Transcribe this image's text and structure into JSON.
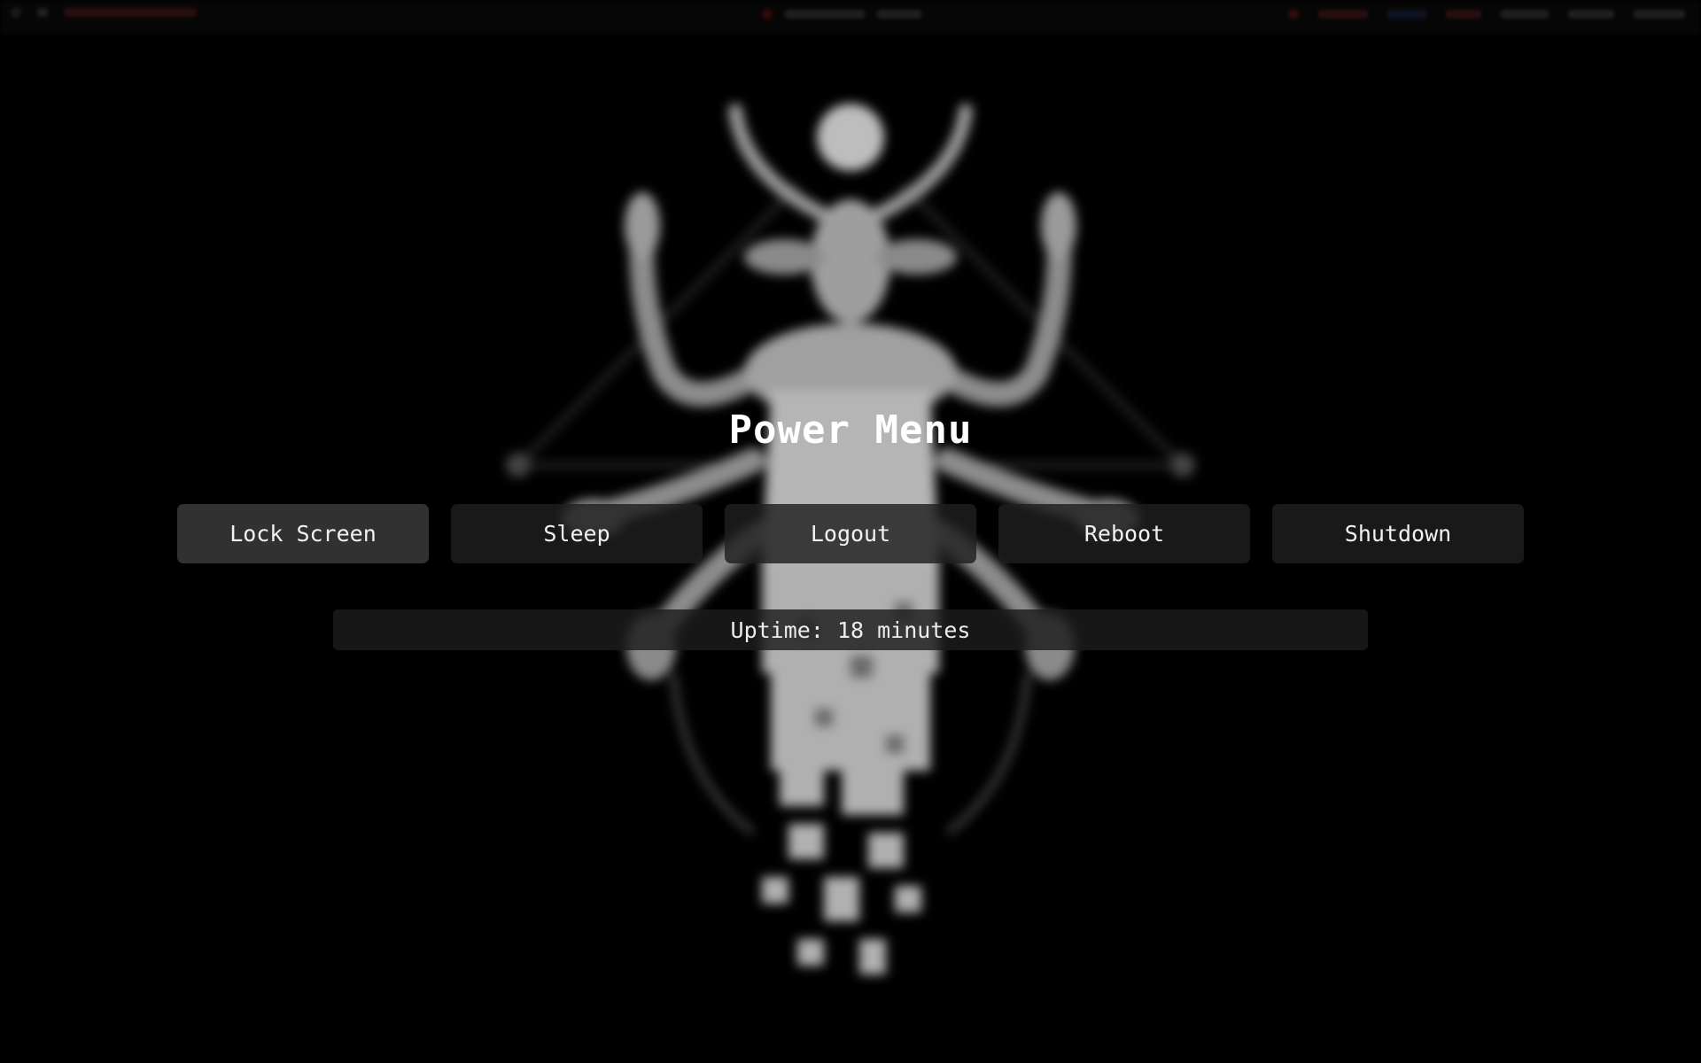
{
  "menu": {
    "title": "Power Menu",
    "buttons": [
      {
        "label": "Lock Screen",
        "selected": true
      },
      {
        "label": "Sleep",
        "selected": false
      },
      {
        "label": "Logout",
        "selected": false
      },
      {
        "label": "Reboot",
        "selected": false
      },
      {
        "label": "Shutdown",
        "selected": false
      }
    ],
    "uptime": "Uptime: 18 minutes"
  },
  "colors": {
    "background": "#000000",
    "button": "#1e1e1e",
    "button_selected": "#343434",
    "text": "#ffffff"
  },
  "icons": {
    "wallpaper": "horned-figure-illustration"
  }
}
